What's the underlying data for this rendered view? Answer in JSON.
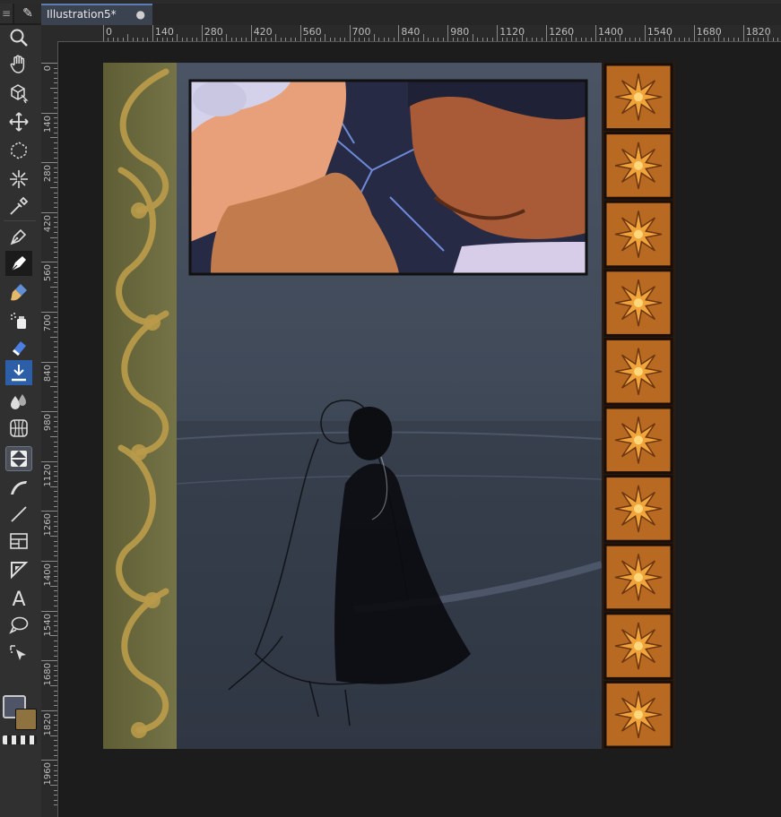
{
  "app": {
    "menu_glyph": "≡",
    "tool_glyph": "✎"
  },
  "document": {
    "tab_title": "Illustration5*",
    "modified_indicator": "●"
  },
  "rulers": {
    "horizontal_labels": [
      "0",
      "140",
      "280",
      "420",
      "560",
      "700",
      "840",
      "980",
      "1120",
      "1260",
      "1400",
      "1540",
      "1680",
      "1820"
    ],
    "vertical_labels": [
      "0",
      "140",
      "280",
      "420",
      "560",
      "700",
      "840",
      "980",
      "1120",
      "1260",
      "1400",
      "1540",
      "1680",
      "1820",
      "1960"
    ]
  },
  "toolbox": {
    "tools": [
      "zoom-tool",
      "pan-tool",
      "transform-3d-tool",
      "move-tool",
      "lasso-select-tool",
      "magic-wand-tool",
      "eyedropper-tool",
      "pen-tool",
      "calligraphy-pen-tool",
      "brush-tool",
      "airbrush-tool",
      "eraser-tool",
      "fill-tool",
      "blend-tool",
      "perspective-grid-tool",
      "gradient-tool",
      "curve-tool",
      "line-tool",
      "panel-tool",
      "ruler-tool",
      "text-tool",
      "speech-balloon-tool",
      "object-select-tool"
    ],
    "active_tool": "gradient-tool",
    "foreground_color": "#4f5566",
    "background_color": "#8e7340"
  },
  "canvas": {
    "background_color": "#1c1c1c",
    "artwork_description_colors": {
      "left_border": "#6b6a3c",
      "right_border": "#b86a22",
      "sea": "#3a4352"
    }
  }
}
